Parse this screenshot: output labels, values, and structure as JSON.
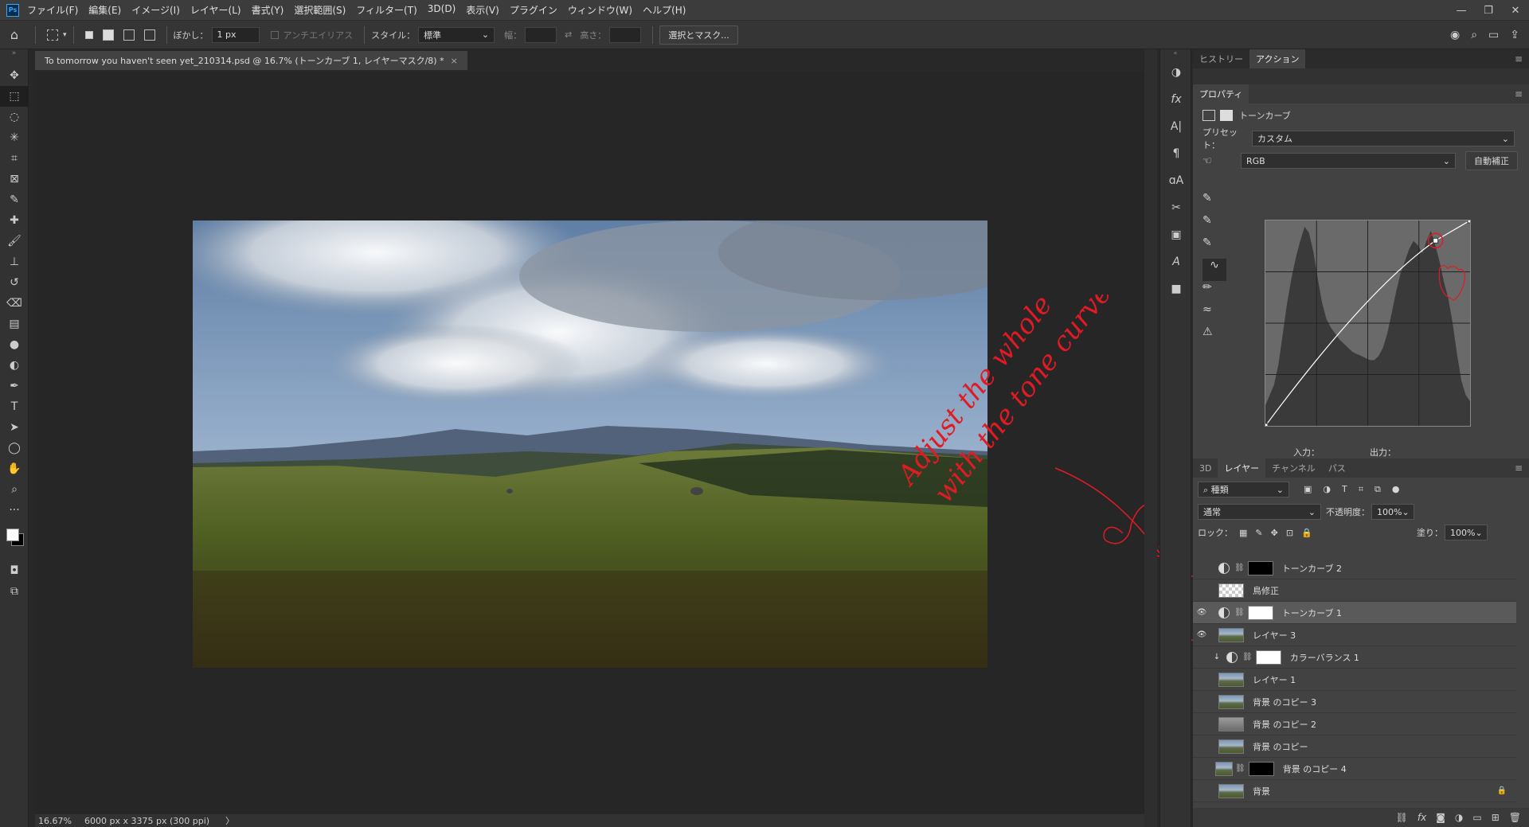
{
  "menu": {
    "logo": "Ps",
    "items": [
      "ファイル(F)",
      "編集(E)",
      "イメージ(I)",
      "レイヤー(L)",
      "書式(Y)",
      "選択範囲(S)",
      "フィルター(T)",
      "3D(D)",
      "表示(V)",
      "プラグイン",
      "ウィンドウ(W)",
      "ヘルプ(H)"
    ]
  },
  "window_controls": [
    "—",
    "❐",
    "✕"
  ],
  "options": {
    "feather_label": "ぼかし：",
    "feather_value": "1 px",
    "antialias_label": "アンチエイリアス",
    "style_label": "スタイル：",
    "style_value": "標準",
    "width_label": "幅：",
    "height_label": "高さ：",
    "select_mask_button": "選択とマスク..."
  },
  "document": {
    "tab_title": "To tomorrow you haven't seen yet_210314.psd @ 16.7% (トーンカーブ 1, レイヤーマスク/8) *",
    "close": "×"
  },
  "status": {
    "zoom": "16.67%",
    "size_info": "6000 px x 3375 px (300 ppi)",
    "arrow": "〉"
  },
  "annotation": {
    "line1": "Adjust the whole",
    "line2": "with the tone curve",
    "color": "#e01b24"
  },
  "panel_top": {
    "tabs": [
      "ヒストリー",
      "アクション"
    ],
    "active": 1
  },
  "properties": {
    "title": "プロパティ",
    "adj_name": "トーンカーブ",
    "preset_label": "プリセット：",
    "preset_value": "カスタム",
    "channel_value": "RGB",
    "auto_button": "自動補正",
    "input_label": "入力：",
    "output_label": "出力："
  },
  "curve": {
    "channel": "RGB",
    "points": [
      [
        0,
        0
      ],
      [
        212,
        230
      ],
      [
        255,
        255
      ]
    ],
    "histogram": [
      0.1,
      0.15,
      0.2,
      0.3,
      0.45,
      0.6,
      0.72,
      0.82,
      0.9,
      0.97,
      0.94,
      0.85,
      0.72,
      0.6,
      0.52,
      0.48,
      0.45,
      0.42,
      0.4,
      0.38,
      0.36,
      0.35,
      0.34,
      0.33,
      0.32,
      0.32,
      0.34,
      0.38,
      0.45,
      0.55,
      0.65,
      0.74,
      0.8,
      0.86,
      0.9,
      0.88,
      0.84,
      0.9,
      0.95,
      0.88,
      0.8,
      0.7,
      0.62,
      0.5,
      0.35,
      0.22,
      0.15,
      0.12
    ]
  },
  "layers_panel": {
    "tabs": [
      "3D",
      "レイヤー",
      "チャンネル",
      "パス"
    ],
    "active": 1,
    "filter_value": "種類",
    "blend_mode": "通常",
    "opacity_label": "不透明度：",
    "opacity_value": "100%",
    "lock_label": "ロック：",
    "fill_label": "塗り：",
    "fill_value": "100%",
    "layers": [
      {
        "name": "トーンカーブ 2",
        "visible": false,
        "kind": "adjustment",
        "mask": "black"
      },
      {
        "name": "鳥修正",
        "visible": false,
        "kind": "pixel",
        "thumb": "checker"
      },
      {
        "name": "トーンカーブ 1",
        "visible": true,
        "kind": "adjustment",
        "mask": "white",
        "selected": true
      },
      {
        "name": "レイヤー 3",
        "visible": true,
        "kind": "pixel",
        "thumb": "land"
      },
      {
        "name": "カラーバランス 1",
        "visible": false,
        "kind": "adjustment",
        "mask": "white",
        "clipped": true
      },
      {
        "name": "レイヤー 1",
        "visible": false,
        "kind": "pixel",
        "thumb": "land"
      },
      {
        "name": "背景 のコピー 3",
        "visible": false,
        "kind": "pixel",
        "thumb": "land"
      },
      {
        "name": "背景 のコピー 2",
        "visible": false,
        "kind": "pixel",
        "thumb": "gray"
      },
      {
        "name": "背景 のコピー",
        "visible": false,
        "kind": "pixel",
        "thumb": "land"
      },
      {
        "name": "背景 のコピー 4",
        "visible": false,
        "kind": "smart",
        "mask": "black"
      },
      {
        "name": "背景",
        "visible": false,
        "kind": "pixel",
        "thumb": "land",
        "locked": true
      }
    ]
  }
}
